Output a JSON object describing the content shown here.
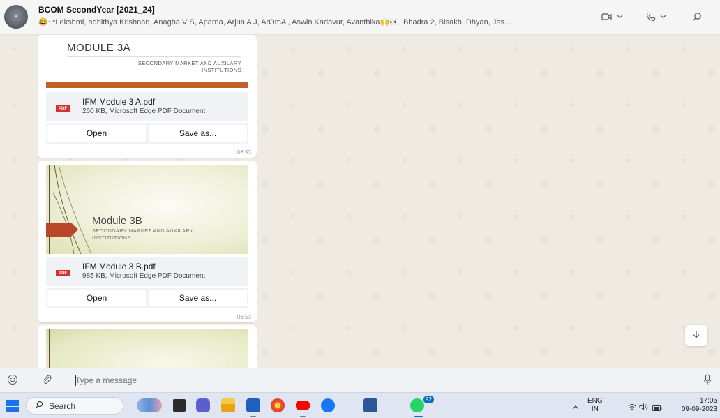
{
  "chat": {
    "title": "BCOM SecondYear [2021_24]",
    "members": "😂~*Lekshmi, adhithya Krishnan, Anagha V S, Aparna, Arjun A J, ArOmAl, Aswin Kadavur, Avanthika🙌👀, Bhadra 2, Bisakh, Dhyan, Jes..."
  },
  "messages": [
    {
      "preview_title": "MODULE 3A",
      "preview_subtitle": "SECONDARY MARKET AND AUXILARY INSTITUTIONS",
      "filename": "IFM Module 3 A.pdf",
      "meta": "260 KB, Microsoft Edge PDF Document",
      "open_label": "Open",
      "save_label": "Save as...",
      "time": "06:53"
    },
    {
      "preview_title": "Module 3B",
      "preview_subtitle": "SECONDARY MARKET AND AUXILARY INSTITUTIONS",
      "filename": "IFM Module 3 B.pdf",
      "meta": "985 KB, Microsoft Edge PDF Document",
      "open_label": "Open",
      "save_label": "Save as...",
      "time": "06:53"
    }
  ],
  "pdf_badge": "PDF",
  "composer": {
    "placeholder": "Type a message"
  },
  "taskbar": {
    "search_label": "Search",
    "whatsapp_badge": "92",
    "lang": "ENG",
    "region": "IN",
    "time": "17:05",
    "date": "09-09-2023"
  },
  "icons": {
    "header": [
      "video-call-icon",
      "voice-call-icon",
      "search-icon"
    ],
    "composer": [
      "emoji-icon",
      "attach-icon",
      "microphone-icon"
    ],
    "scroll": "arrow-down-icon"
  },
  "colors": {
    "accent_orange": "#c0612a",
    "pdf_red": "#d63131",
    "chat_bg": "#efeae2"
  }
}
